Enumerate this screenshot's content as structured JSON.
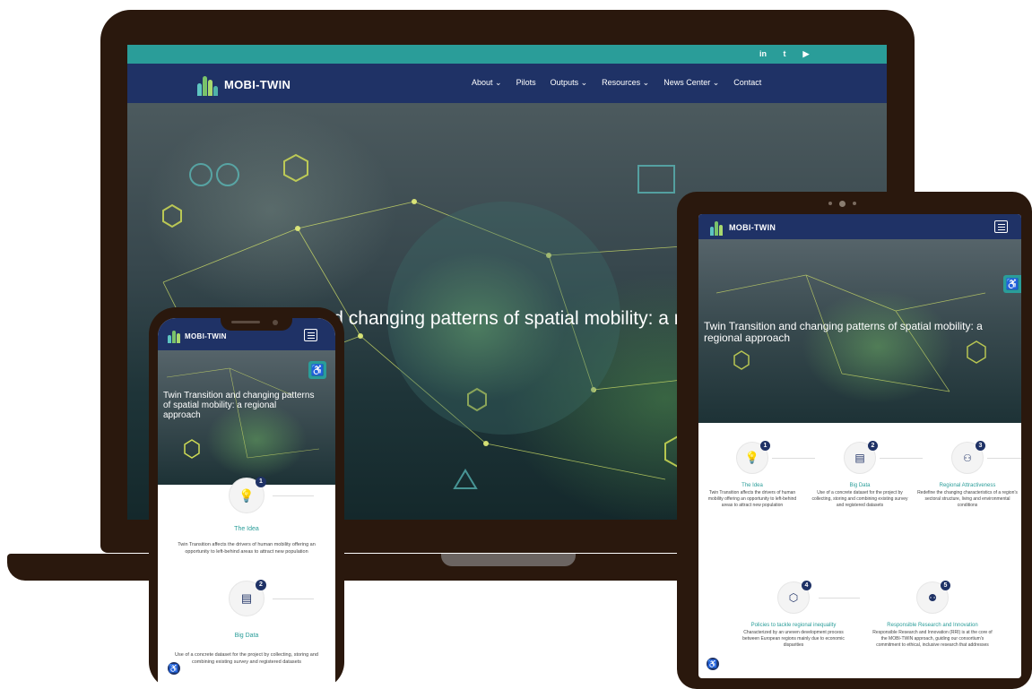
{
  "brand": {
    "name": "MOBI-TWIN"
  },
  "social": {
    "linkedin": "in",
    "twitter": "t",
    "youtube": "▶"
  },
  "nav": {
    "items": [
      "About ⌄",
      "Pilots",
      "Outputs ⌄",
      "Resources ⌄",
      "News Center ⌄",
      "Contact"
    ]
  },
  "hero": {
    "laptop_title": "Twin Transition and changing patterns of spatial mobility: a regional approach",
    "tablet_title": "Twin Transition and changing patterns of spatial mobility: a regional approach",
    "phone_title": "Twin Transition and changing patterns of spatial mobility: a regional approach"
  },
  "steps": [
    {
      "num": "1",
      "icon": "lightbulb-icon",
      "title": "The Idea",
      "desc": "Twin Transition affects the drivers of human mobility offering an opportunity to left-behind areas to attract new population"
    },
    {
      "num": "2",
      "icon": "database-icon",
      "title": "Big Data",
      "desc": "Use of a concrete dataset for the project by collecting, storing and combining existing survey and registered datasets"
    },
    {
      "num": "3",
      "icon": "network-icon",
      "title": "Regional Attractiveness",
      "desc": "Redefine the changing characteristics of a region's sectoral structure, living and environmental conditions"
    },
    {
      "num": "4",
      "icon": "hexagon-icon",
      "title": "Policies to tackle regional inequality",
      "desc": "Characterized by an uneven development process between European regions mainly due to economic disparities"
    },
    {
      "num": "5",
      "icon": "people-icon",
      "title": "Responsible Research and Innovation",
      "desc": "Responsible Research and Innovation (RRI) is at the core of the MOBI-TWIN approach, guiding our consortium's commitment to ethical, inclusive research that addresses"
    }
  ],
  "phone_steps": {
    "idea_desc": "Twin Transition affects the drivers of human mobility offering an opportunity to left-behind areas to attract new population",
    "bigdata_desc": "Use of a concrete dataset for the project by collecting, storing and combining existing survey and registered datasets"
  },
  "icons": {
    "accessibility": "♿",
    "hamburger": "menu-icon"
  },
  "colors": {
    "teal": "#2a9d99",
    "navy": "#1f3266",
    "device": "#2a180d"
  }
}
